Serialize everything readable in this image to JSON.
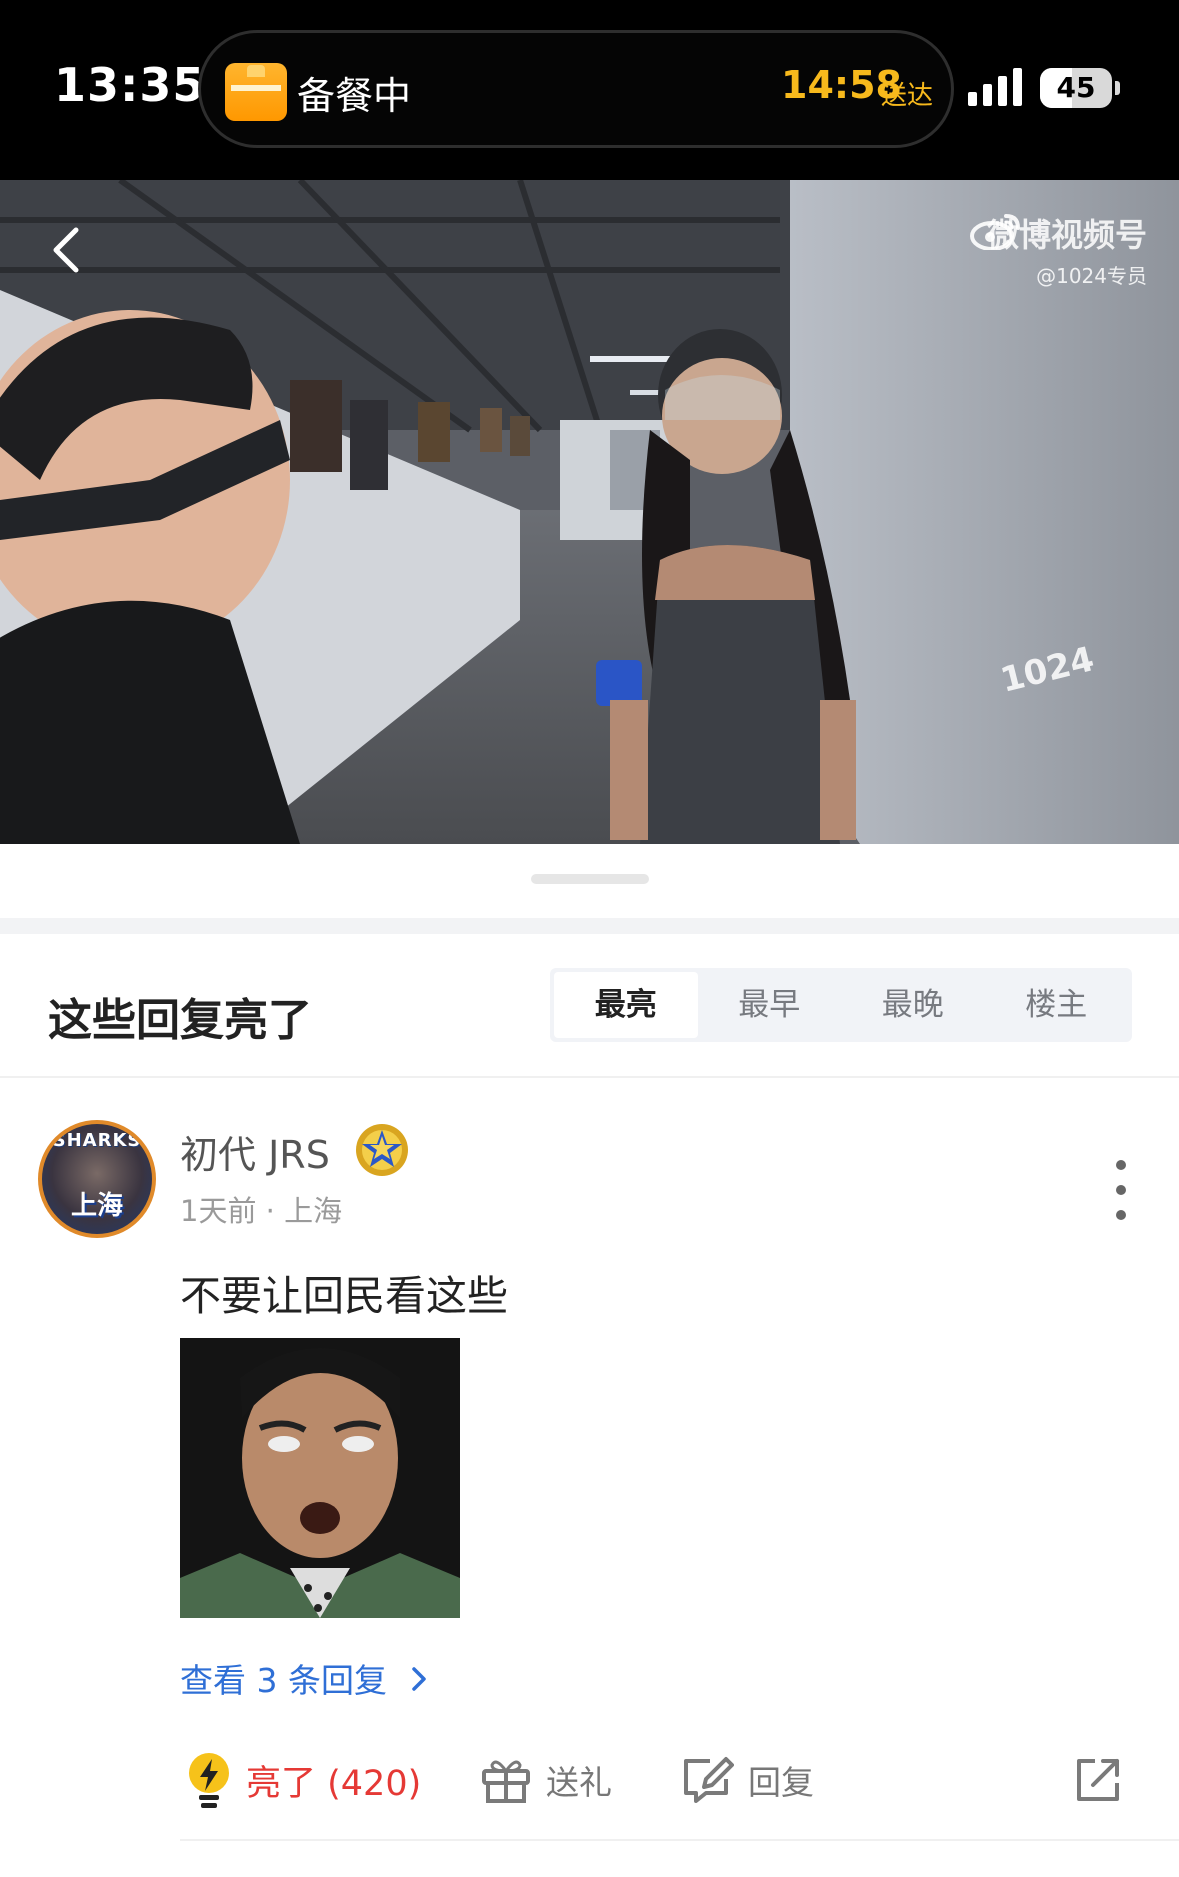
{
  "status_bar": {
    "time": "13:35",
    "live_activity": {
      "label": "备餐中",
      "eta": "14:58",
      "eta_suffix": "送达",
      "accent": "#f7b91c"
    },
    "signal_bars": 4,
    "battery_percent": 45,
    "battery_text": "45"
  },
  "video": {
    "back_icon": "chevron-left-icon",
    "watermark_brand": "微博视频号",
    "watermark_user": "@1024专员",
    "watermark_corner": "1024"
  },
  "comments_section": {
    "title": "这些回复亮了",
    "sort_tabs": [
      {
        "label": "最亮",
        "active": true
      },
      {
        "label": "最早",
        "active": false
      },
      {
        "label": "最晚",
        "active": false
      },
      {
        "label": "楼主",
        "active": false
      }
    ],
    "comment": {
      "avatar_text_top": "SHARKS",
      "avatar_text_bottom": "上海",
      "username": "初代 JRS",
      "badge_icon": "gold-star-badge-icon",
      "meta": "1天前 · 上海",
      "text": "不要让回民看这些",
      "view_replies": "查看 3 条回复",
      "actions": {
        "like_label": "亮了 (420)",
        "gift_label": "送礼",
        "reply_label": "回复",
        "share_icon": "share-icon"
      },
      "like_color": "#e53935",
      "link_color": "#2f6fd6"
    }
  }
}
